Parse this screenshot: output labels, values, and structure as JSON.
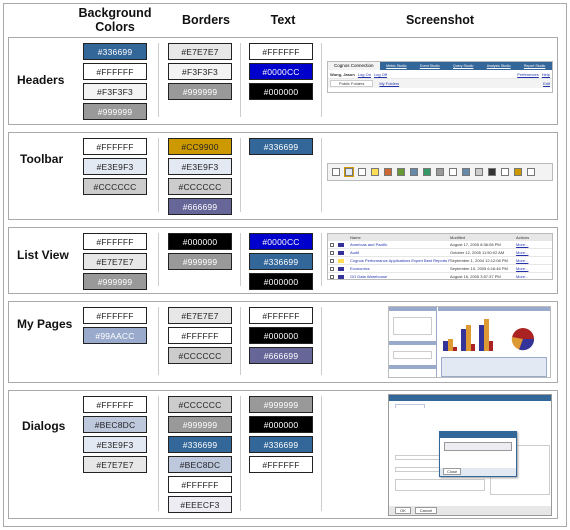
{
  "column_headers": {
    "background": "Background Colors",
    "borders": "Borders",
    "text": "Text",
    "screenshot": "Screenshot"
  },
  "sections": [
    {
      "name": "Headers",
      "background": [
        "#336699",
        "#FFFFFF",
        "#F3F3F3",
        "#999999"
      ],
      "borders": [
        "#E7E7E7",
        "#F3F3F3",
        "#999999"
      ],
      "text": [
        "#FFFFFF",
        "#0000CC",
        "#000000"
      ]
    },
    {
      "name": "Toolbar",
      "background": [
        "#FFFFFF",
        "#E3E9F3",
        "#CCCCCC"
      ],
      "borders": [
        "#CC9900",
        "#E3E9F3",
        "#CCCCCC",
        "#666699"
      ],
      "text": [
        "#336699"
      ]
    },
    {
      "name": "List View",
      "background": [
        "#FFFFFF",
        "#E7E7E7",
        "#999999"
      ],
      "borders": [
        "#000000",
        "#999999"
      ],
      "text": [
        "#0000CC",
        "#336699",
        "#000000"
      ]
    },
    {
      "name": "My Pages",
      "background": [
        "#FFFFFF",
        "#99AACC"
      ],
      "borders": [
        "#E7E7E7",
        "#FFFFFF",
        "#CCCCCC"
      ],
      "text": [
        "#FFFFFF",
        "#000000",
        "#666699"
      ]
    },
    {
      "name": "Dialogs",
      "background": [
        "#FFFFFF",
        "#BEC8DC",
        "#E3E9F3",
        "#E7E7E7"
      ],
      "borders": [
        "#CCCCCC",
        "#999999",
        "#336699",
        "#BEC8DC",
        "#FFFFFF",
        "#EEECF3"
      ],
      "text": [
        "#999999",
        "#000000",
        "#336699",
        "#FFFFFF"
      ]
    }
  ],
  "screenshots": {
    "headers": {
      "app_title": "Cognos Connection",
      "studios": [
        "Metric Studio",
        "Event Studio",
        "Query Studio",
        "Analysis Studio",
        "Report Studio"
      ],
      "user": "Wong, Jason",
      "log_on": "Log On",
      "log_off": "Log Off",
      "preferences": "Preferences",
      "help": "Help",
      "tabs": [
        "Public Folders",
        "My Folders"
      ],
      "edit": "Edit"
    },
    "list_view": {
      "columns": [
        "Name",
        "Modified",
        "Actions"
      ],
      "rows": [
        {
          "name": "Americas and Pacific",
          "modified": "August 17, 2005 8:36:08 PM",
          "action": "More..."
        },
        {
          "name": "Audit",
          "modified": "October 12, 2005 11:50:02 AM",
          "action": "More..."
        },
        {
          "name": "Cognos Performance Applications Expert Best Reports For IRP",
          "modified": "September 1, 2004 12:12:08 PM",
          "action": "More..."
        },
        {
          "name": "Economics",
          "modified": "September 15, 2005 6:16:46 PM",
          "action": "More..."
        },
        {
          "name": "GO Data Warehouse",
          "modified": "August 16, 2005 3:57:37 PM",
          "action": "More..."
        }
      ]
    },
    "dialogs": {
      "ok": "OK",
      "cancel": "Cancel",
      "close": "Close"
    }
  }
}
